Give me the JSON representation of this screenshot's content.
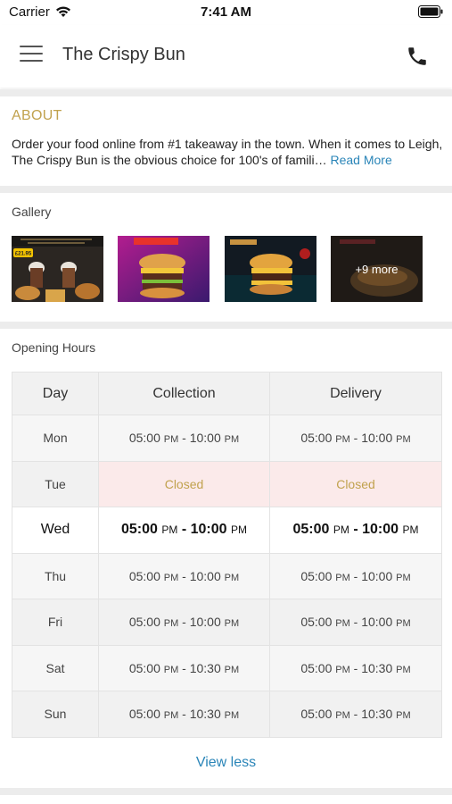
{
  "status_bar": {
    "carrier": "Carrier",
    "time": "7:41 AM",
    "wifi_icon": "wifi-icon",
    "battery_icon": "battery-icon"
  },
  "header": {
    "title": "The Crispy Bun",
    "menu_icon": "hamburger-menu-icon",
    "phone_icon": "phone-icon"
  },
  "about": {
    "heading": "ABOUT",
    "text": "Order your food online from #1 takeaway in the town. When it comes to Leigh, The Crispy Bun is the obvious choice for 100's of famili…",
    "read_more": "Read More"
  },
  "gallery": {
    "heading": "Gallery",
    "more_label": "+9 more",
    "price_tag": "£21.95"
  },
  "opening_hours": {
    "heading": "Opening Hours",
    "columns": [
      "Day",
      "Collection",
      "Delivery"
    ],
    "rows": [
      {
        "day": "Mon",
        "collection": {
          "from": "05:00",
          "from_ampm": "PM",
          "sep": "-",
          "to": "10:00",
          "to_ampm": "PM"
        },
        "delivery": {
          "from": "05:00",
          "from_ampm": "PM",
          "sep": "-",
          "to": "10:00",
          "to_ampm": "PM"
        }
      },
      {
        "day": "Tue",
        "collection_closed": "Closed",
        "delivery_closed": "Closed"
      },
      {
        "day": "Wed",
        "collection": {
          "from": "05:00",
          "from_ampm": "PM",
          "sep": "-",
          "to": "10:00",
          "to_ampm": "PM"
        },
        "delivery": {
          "from": "05:00",
          "from_ampm": "PM",
          "sep": "-",
          "to": "10:00",
          "to_ampm": "PM"
        }
      },
      {
        "day": "Thu",
        "collection": {
          "from": "05:00",
          "from_ampm": "PM",
          "sep": "-",
          "to": "10:00",
          "to_ampm": "PM"
        },
        "delivery": {
          "from": "05:00",
          "from_ampm": "PM",
          "sep": "-",
          "to": "10:00",
          "to_ampm": "PM"
        }
      },
      {
        "day": "Fri",
        "collection": {
          "from": "05:00",
          "from_ampm": "PM",
          "sep": "-",
          "to": "10:00",
          "to_ampm": "PM"
        },
        "delivery": {
          "from": "05:00",
          "from_ampm": "PM",
          "sep": "-",
          "to": "10:00",
          "to_ampm": "PM"
        }
      },
      {
        "day": "Sat",
        "collection": {
          "from": "05:00",
          "from_ampm": "PM",
          "sep": "-",
          "to": "10:30",
          "to_ampm": "PM"
        },
        "delivery": {
          "from": "05:00",
          "from_ampm": "PM",
          "sep": "-",
          "to": "10:30",
          "to_ampm": "PM"
        }
      },
      {
        "day": "Sun",
        "collection": {
          "from": "05:00",
          "from_ampm": "PM",
          "sep": "-",
          "to": "10:30",
          "to_ampm": "PM"
        },
        "delivery": {
          "from": "05:00",
          "from_ampm": "PM",
          "sep": "-",
          "to": "10:30",
          "to_ampm": "PM"
        }
      }
    ],
    "toggle_label": "View less"
  },
  "colors": {
    "accent_gold": "#c1a24e",
    "link_blue": "#2a85b8",
    "closed_bg": "#fbeaea"
  }
}
